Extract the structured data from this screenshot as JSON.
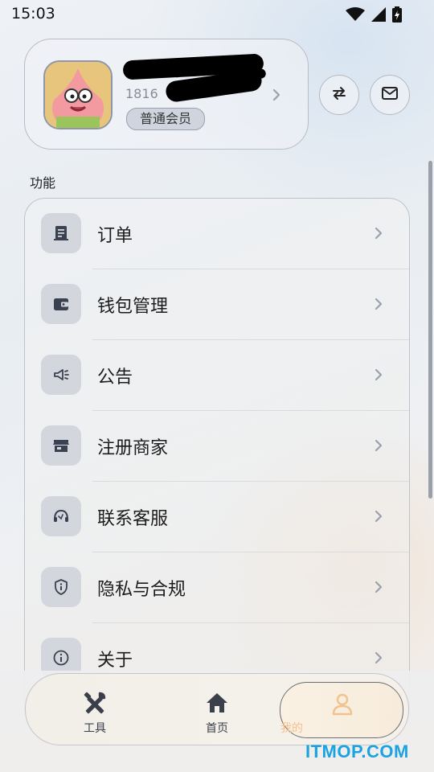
{
  "status_bar": {
    "time": "15:03",
    "icons": [
      "wifi-icon",
      "signal-icon",
      "battery-charging-icon"
    ]
  },
  "profile": {
    "phone_primary": "18160",
    "phone_secondary": "1816",
    "member_level": "普通会员",
    "avatar_icon": "patrick-star-avatar"
  },
  "header_actions": {
    "switch_icon": "swap-arrows-icon",
    "message_icon": "mail-icon"
  },
  "section": {
    "title": "功能"
  },
  "menu": {
    "items": [
      {
        "label": "订单",
        "icon": "receipt-icon"
      },
      {
        "label": "钱包管理",
        "icon": "wallet-icon"
      },
      {
        "label": "公告",
        "icon": "megaphone-icon"
      },
      {
        "label": "注册商家",
        "icon": "storefront-icon"
      },
      {
        "label": "联系客服",
        "icon": "headset-icon"
      },
      {
        "label": "隐私与合规",
        "icon": "shield-icon"
      },
      {
        "label": "关于",
        "icon": "info-icon"
      }
    ]
  },
  "bottom_nav": {
    "items": [
      {
        "label": "工具",
        "icon": "tools-icon"
      },
      {
        "label": "首页",
        "icon": "home-icon"
      },
      {
        "label": "我的",
        "icon": "person-icon",
        "active": true
      }
    ],
    "active_color": "#f2c28e"
  },
  "watermark": "ITMOP.COM",
  "colors": {
    "icon": "#3a4150",
    "chevron": "#9aa1ad",
    "watermark": "#1aa3e0"
  }
}
